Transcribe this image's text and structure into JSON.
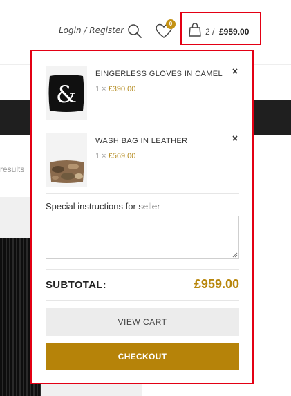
{
  "header": {
    "login_label": "Login / Register",
    "search_icon": "search-icon",
    "wishlist_count": "0",
    "cart": {
      "count": "2",
      "separator": " / ",
      "total": "£959.00"
    }
  },
  "background": {
    "results_fragment": "results"
  },
  "cart_dropdown": {
    "items": [
      {
        "name": "EINGERLESS GLOVES IN CAMEL",
        "qty_prefix": "1 × ",
        "price": "£390.00",
        "thumb": "ampersand-pillow-image"
      },
      {
        "name": "WASH BAG IN LEATHER",
        "qty_prefix": "1 × ",
        "price": "£569.00",
        "thumb": "camo-wash-bag-image"
      }
    ],
    "instructions_label": "Special instructions for seller",
    "instructions_value": "",
    "subtotal_label": "SUBTOTAL:",
    "subtotal_value": "£959.00",
    "view_cart_label": "VIEW CART",
    "checkout_label": "CHECKOUT"
  },
  "colors": {
    "accent": "#b68309",
    "highlight_border": "#e30014",
    "badge": "#c49214"
  }
}
